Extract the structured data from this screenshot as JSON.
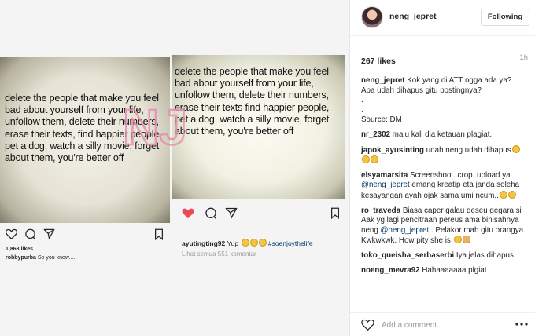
{
  "header": {
    "username": "neng_jepret",
    "follow_label": "Following"
  },
  "post_meta": {
    "likes": "267 likes",
    "time_ago": "1h"
  },
  "comments": [
    {
      "user": "neng_jepret",
      "parts": [
        {
          "t": "Kok yang di ATT ngga ada ya? Apa udah dihapus gitu postingnya?"
        }
      ],
      "extra": [
        ".",
        ".",
        "Source: DM"
      ]
    },
    {
      "user": "nr_2302",
      "parts": [
        {
          "t": "malu kali dia ketauan plagiat.."
        }
      ]
    },
    {
      "user": "japok_ayusinting",
      "parts": [
        {
          "t": "udah neng udah dihapus"
        }
      ],
      "emoji": [
        "grin",
        "grin",
        "grin"
      ]
    },
    {
      "user": "elsyamarsita",
      "parts": [
        {
          "t": "Screenshoot..crop..upload ya "
        },
        {
          "m": "@neng_jepret"
        },
        {
          "t": " emang kreatip eta janda soleha kesayangan ayah ojak sama umi ncum.."
        }
      ],
      "emoji": [
        "grin",
        "grin"
      ]
    },
    {
      "user": "ro_traveda",
      "parts": [
        {
          "t": "Biasa caper galau deseu gegara si Aak yg lagi pencitraan pereus ama binisahnya neng "
        },
        {
          "m": "@neng_jepret"
        },
        {
          "t": " . Pelakor mah gitu orangya. Kwkwkwk. How pity she is "
        }
      ],
      "emoji": [
        "grin",
        "thumb"
      ]
    },
    {
      "user": "toko_queisha_serbaserbi",
      "parts": [
        {
          "t": "Iya jelas dihapus"
        }
      ]
    },
    {
      "user": "noeng_mevra92",
      "parts": [
        {
          "t": "Hahaaaaaaa plgiat"
        }
      ]
    }
  ],
  "add_comment": {
    "placeholder": "Add a comment…"
  },
  "left_post": {
    "quote": "delete the people that make you feel bad about yourself from your life, unfollow them, delete their numbers, erase their texts, find happier people, pet a dog, watch a silly movie, forget about them, you're better off",
    "likes": "1,863 likes",
    "caption_user": "robbypurba",
    "caption_text": "So you know...."
  },
  "right_post": {
    "quote": "delete the people that make you feel bad about yourself from your life, unfollow them, delete their numbers, erase their texts find happier people, pet a dog, watch a silly movie, forget about them, you're better off",
    "caption_user": "ayutingting92",
    "caption_text": "Yup",
    "hashtag": "#soenjoythelife",
    "view_comments": "Lihat semua 551 komentar"
  },
  "colors": {
    "like_red": "#ed4956",
    "mention": "#003569",
    "watermark": "#e58fb0"
  }
}
